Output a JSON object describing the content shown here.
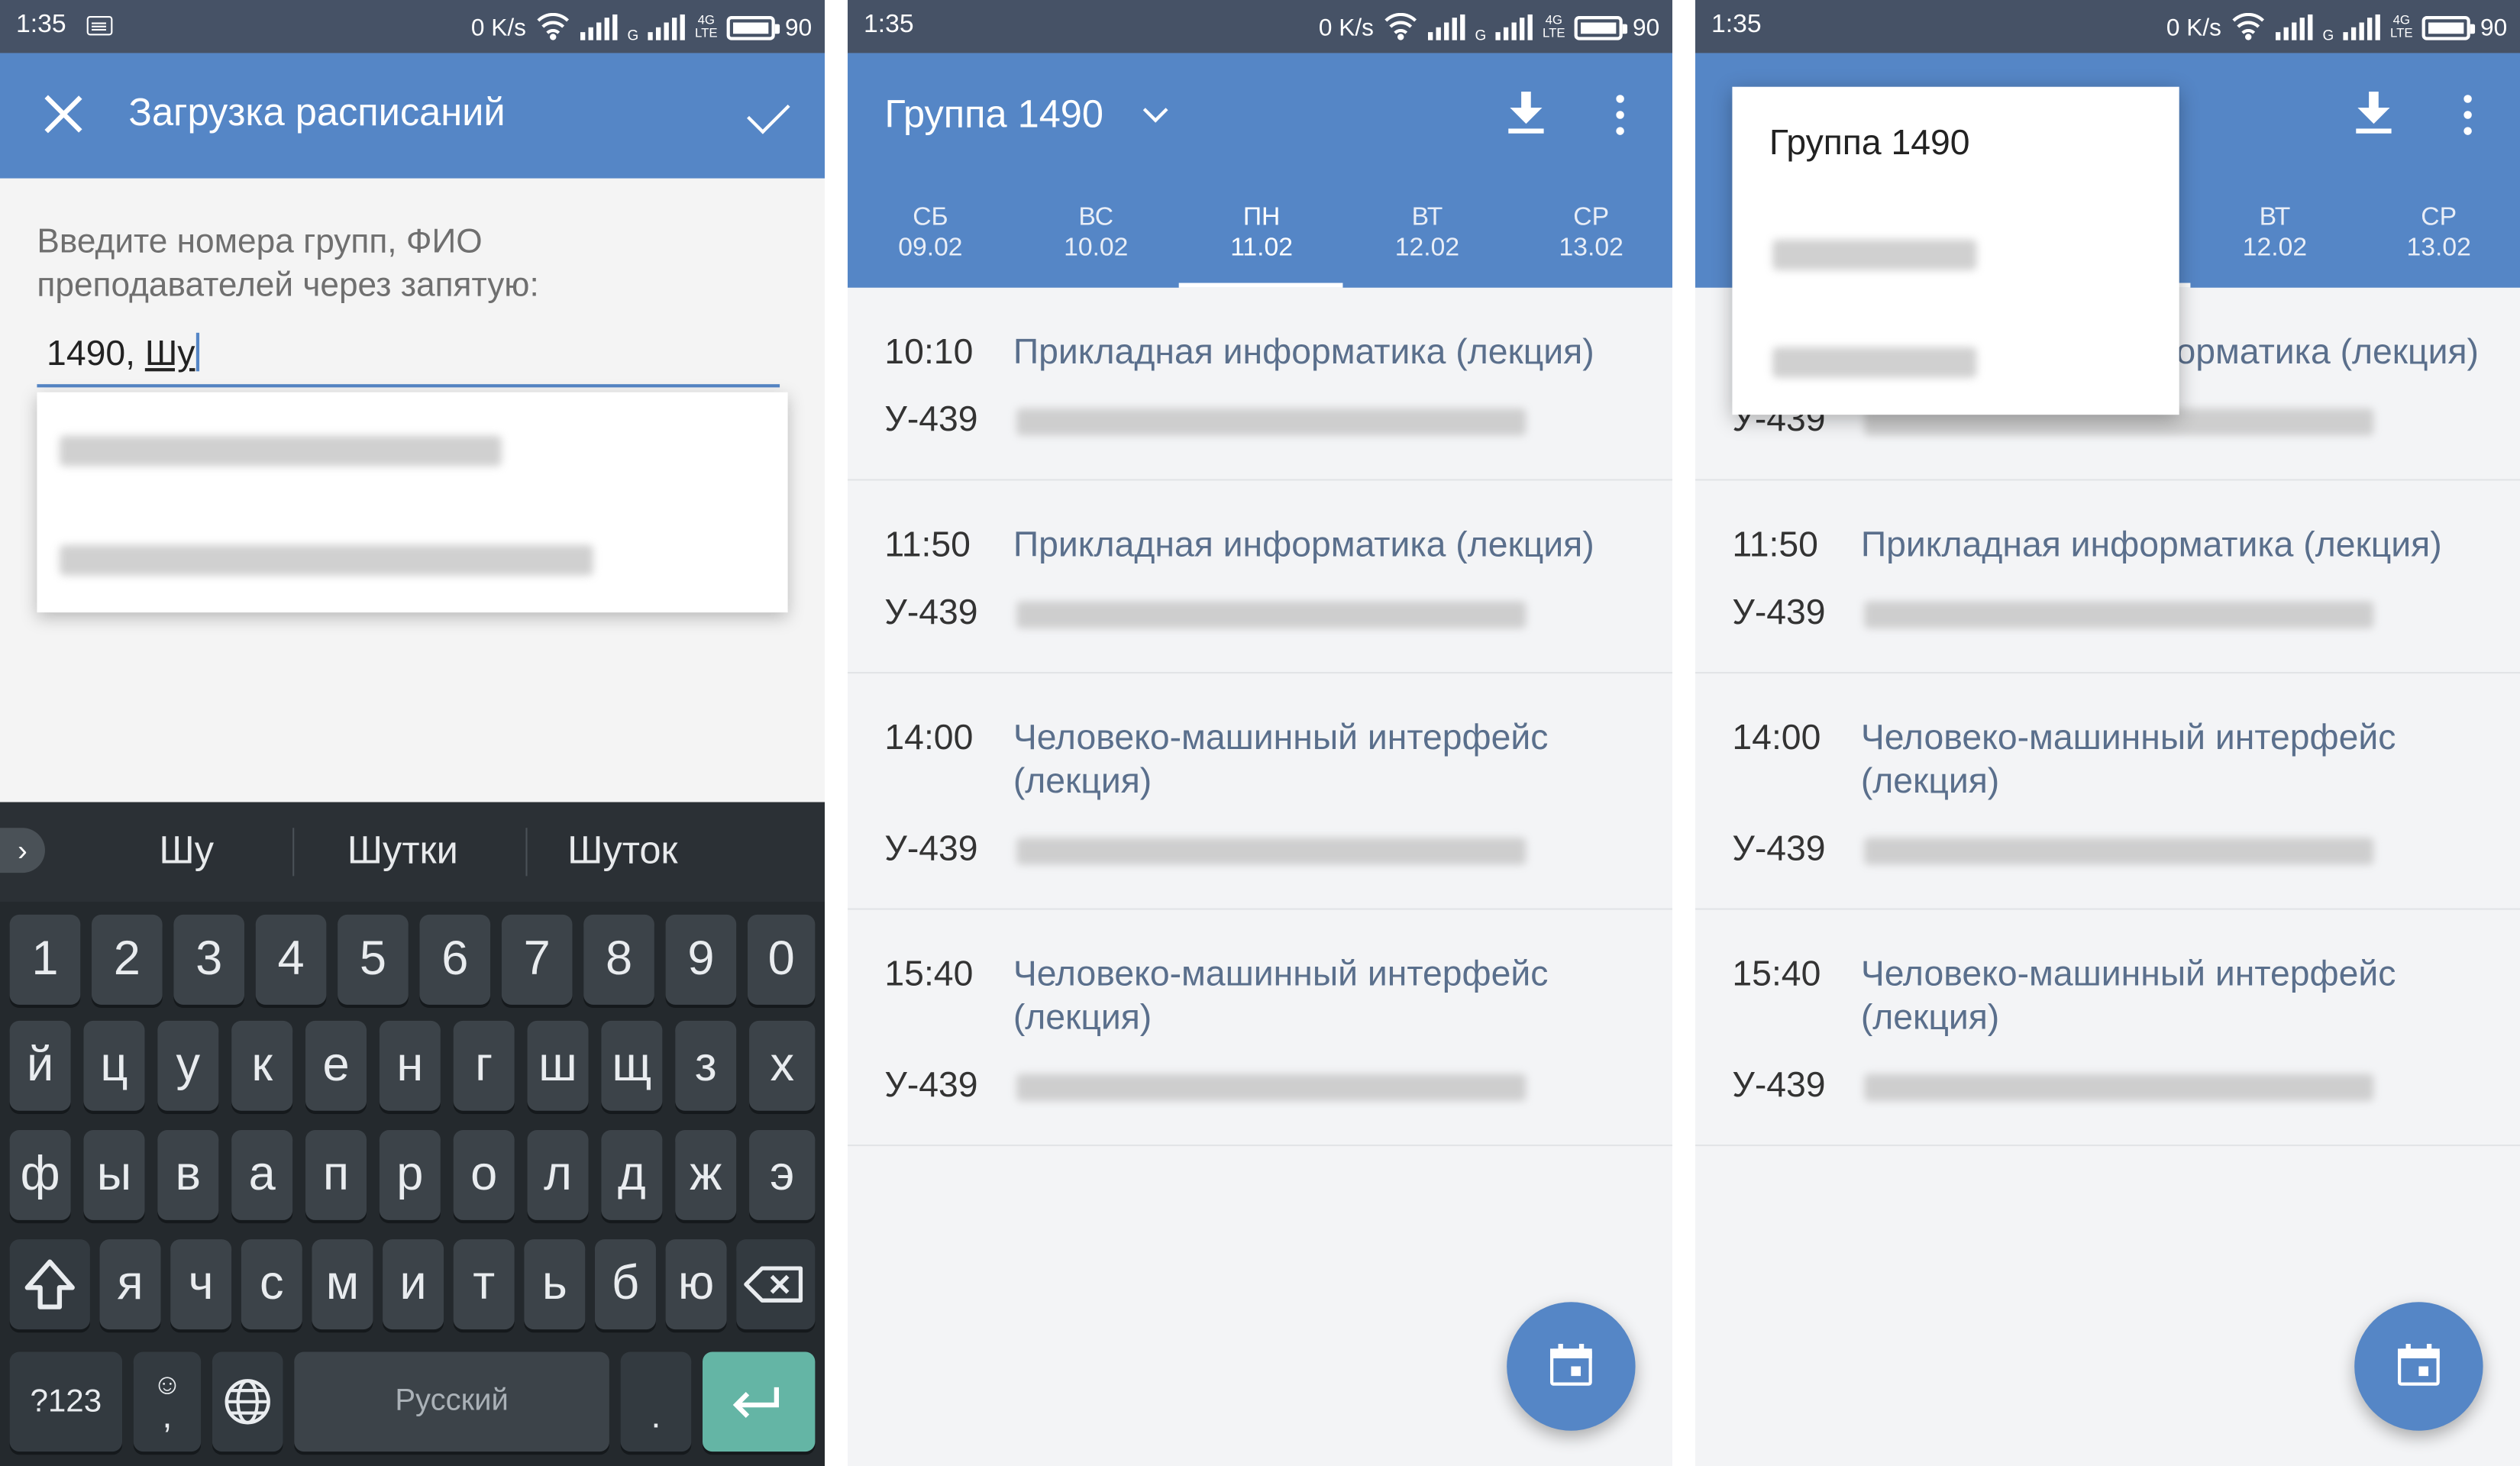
{
  "status": {
    "time": "1:35",
    "speed": "0 K/s",
    "net1": "G",
    "net2": "4G",
    "net2b": "LTE",
    "battery": "90"
  },
  "screen1": {
    "title": "Загрузка расписаний",
    "prompt": "Введите номера групп, ФИО преподавателей через запятую:",
    "input_prefix": "1490, ",
    "input_current": "Шу",
    "keyboard": {
      "suggestions": [
        "Шу",
        "Шутки",
        "Шуток"
      ],
      "row_digits": [
        "1",
        "2",
        "3",
        "4",
        "5",
        "6",
        "7",
        "8",
        "9",
        "0"
      ],
      "row1": [
        "й",
        "ц",
        "у",
        "к",
        "е",
        "н",
        "г",
        "ш",
        "щ",
        "з",
        "х"
      ],
      "row2": [
        "ф",
        "ы",
        "в",
        "а",
        "п",
        "р",
        "о",
        "л",
        "д",
        "ж",
        "э"
      ],
      "row3": [
        "я",
        "ч",
        "с",
        "м",
        "и",
        "т",
        "ь",
        "б",
        "ю"
      ],
      "num_label": "?123",
      "emoji_label": "☺",
      "comma_label": ",",
      "space_label": "Русский",
      "period_label": "."
    }
  },
  "screen2": {
    "group_title": "Группа 1490",
    "tabs": [
      {
        "day": "СБ",
        "date": "09.02"
      },
      {
        "day": "ВС",
        "date": "10.02"
      },
      {
        "day": "ПН",
        "date": "11.02"
      },
      {
        "day": "ВТ",
        "date": "12.02"
      },
      {
        "day": "СР",
        "date": "13.02"
      }
    ],
    "events": [
      {
        "time": "10:10",
        "name": "Прикладная информатика (лекция)",
        "room": "У-439"
      },
      {
        "time": "11:50",
        "name": "Прикладная информатика (лекция)",
        "room": "У-439"
      },
      {
        "time": "14:00",
        "name": "Человеко-машинный интерфейс (лекция)",
        "room": "У-439"
      },
      {
        "time": "15:40",
        "name": "Человеко-машинный интерфейс (лекция)",
        "room": "У-439"
      }
    ]
  },
  "screen3": {
    "menu_item": "Группа 1490",
    "tabs": [
      {
        "day": "ВТ",
        "date": "12.02"
      },
      {
        "day": "СР",
        "date": "13.02"
      }
    ],
    "first_event_visible": "орматика (лекция)",
    "first_room_visible": "У-439",
    "events": [
      {
        "time": "11:50",
        "name": "Прикладная информатика (лекция)",
        "room": "У-439"
      },
      {
        "time": "14:00",
        "name": "Человеко-машинный интерфейс (лекция)",
        "room": "У-439"
      },
      {
        "time": "15:40",
        "name": "Человеко-машинный интерфейс (лекция)",
        "room": "У-439"
      }
    ]
  }
}
